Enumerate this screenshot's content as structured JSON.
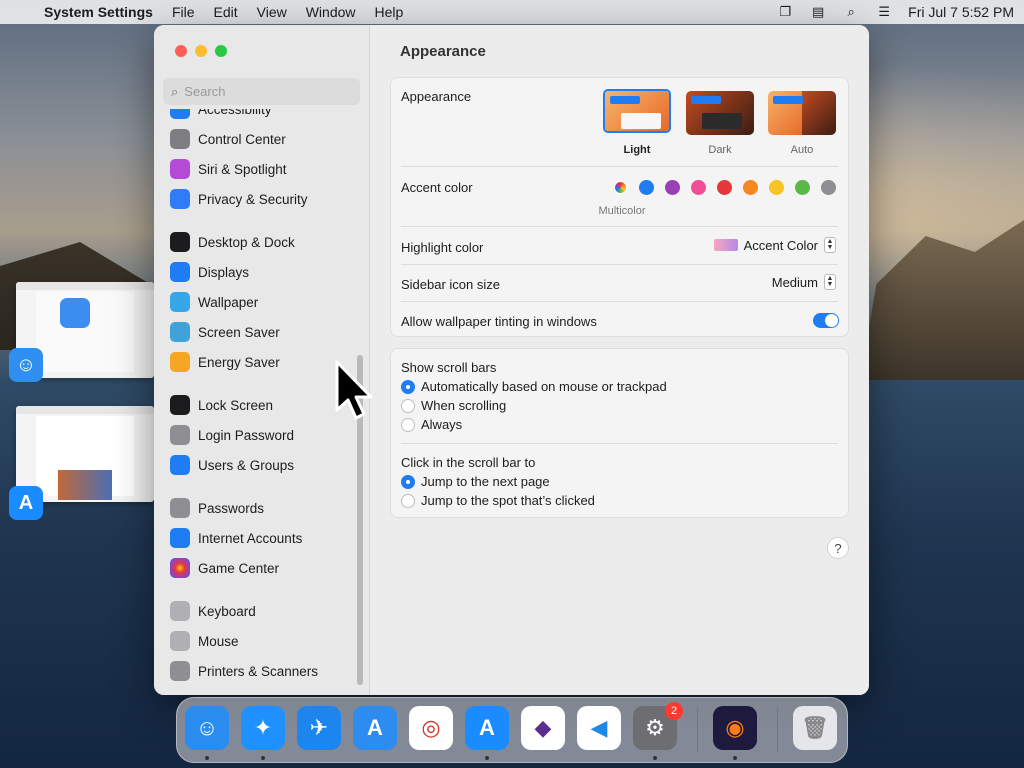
{
  "menubar": {
    "app_name": "System Settings",
    "menus": [
      "File",
      "Edit",
      "View",
      "Window",
      "Help"
    ],
    "clock": "Fri Jul 7  5:52 PM"
  },
  "sidebar": {
    "search_placeholder": "Search",
    "items": [
      {
        "label": "Accessibility",
        "icon": "accessibility-icon",
        "color": "#1f7cf2"
      },
      {
        "label": "Control Center",
        "icon": "control-center-icon",
        "color": "#7d7d82"
      },
      {
        "label": "Siri & Spotlight",
        "icon": "siri-icon",
        "color": "#b44bd6"
      },
      {
        "label": "Privacy & Security",
        "icon": "hand-icon",
        "color": "#2f7cf6"
      },
      {
        "label": "Desktop & Dock",
        "icon": "dock-icon",
        "color": "#1c1c1e"
      },
      {
        "label": "Displays",
        "icon": "sun-icon",
        "color": "#1f7cf2"
      },
      {
        "label": "Wallpaper",
        "icon": "flower-icon",
        "color": "#35a7e8"
      },
      {
        "label": "Screen Saver",
        "icon": "screen-saver-icon",
        "color": "#3fa2d8"
      },
      {
        "label": "Energy Saver",
        "icon": "bulb-icon",
        "color": "#f5a623"
      },
      {
        "label": "Lock Screen",
        "icon": "lock-icon",
        "color": "#1c1c1e"
      },
      {
        "label": "Login Password",
        "icon": "lock-gray-icon",
        "color": "#8e8e93"
      },
      {
        "label": "Users & Groups",
        "icon": "users-icon",
        "color": "#1f7cf2"
      },
      {
        "label": "Passwords",
        "icon": "key-icon",
        "color": "#8e8e93"
      },
      {
        "label": "Internet Accounts",
        "icon": "at-icon",
        "color": "#1f7cf2"
      },
      {
        "label": "Game Center",
        "icon": "game-center-icon",
        "color": "#ffffff"
      },
      {
        "label": "Keyboard",
        "icon": "keyboard-icon",
        "color": "#b0b0b4"
      },
      {
        "label": "Mouse",
        "icon": "mouse-icon",
        "color": "#b0b0b4"
      },
      {
        "label": "Printers & Scanners",
        "icon": "printer-icon",
        "color": "#8e8e93"
      }
    ]
  },
  "content": {
    "title": "Appearance",
    "appearance": {
      "label": "Appearance",
      "options": [
        {
          "label": "Light",
          "selected": true
        },
        {
          "label": "Dark",
          "selected": false
        },
        {
          "label": "Auto",
          "selected": false
        }
      ]
    },
    "accent": {
      "label": "Accent color",
      "caption": "Multicolor",
      "colors": [
        "multicolor",
        "#1f7cf2",
        "#9b3fb5",
        "#f24e98",
        "#e5383b",
        "#f5871f",
        "#f7c325",
        "#58b947",
        "#8e8e93"
      ]
    },
    "highlight": {
      "label": "Highlight color",
      "value": "Accent Color"
    },
    "sidebar_icon_size": {
      "label": "Sidebar icon size",
      "value": "Medium"
    },
    "wallpaper_tinting": {
      "label": "Allow wallpaper tinting in windows",
      "on": true
    },
    "scroll_bars": {
      "label": "Show scroll bars",
      "options": [
        "Automatically based on mouse or trackpad",
        "When scrolling",
        "Always"
      ],
      "selected": 0
    },
    "click_scroll": {
      "label": "Click in the scroll bar to",
      "options": [
        "Jump to the next page",
        "Jump to the spot that’s clicked"
      ],
      "selected": 0
    },
    "help_label": "?"
  },
  "dock": {
    "apps": [
      {
        "name": "finder-icon",
        "glyph": "☺",
        "color": "#2b8cf0",
        "running": true
      },
      {
        "name": "safari-icon",
        "glyph": "✦",
        "color": "#1e90ff",
        "running": true
      },
      {
        "name": "testflight-icon",
        "glyph": "✈",
        "color": "#1c86ee",
        "running": false
      },
      {
        "name": "xcode-appstore-icon",
        "glyph": "A",
        "color": "#2d8cf0",
        "running": false
      },
      {
        "name": "chrome-icon",
        "glyph": "◎",
        "color": "#ffffff",
        "running": false
      },
      {
        "name": "app-store-icon",
        "glyph": "A",
        "color": "#1b8cff",
        "running": true
      },
      {
        "name": "visual-studio-icon",
        "glyph": "◆",
        "color": "#ffffff",
        "running": false
      },
      {
        "name": "vscode-icon",
        "glyph": "◀",
        "color": "#ffffff",
        "running": false
      },
      {
        "name": "system-settings-icon",
        "glyph": "⚙",
        "color": "#6d6d72",
        "running": true,
        "badge": "2"
      },
      {
        "name": "firefox-icon",
        "glyph": "◉",
        "color": "#1e1a3e",
        "running": true
      },
      {
        "name": "trash-icon",
        "glyph": "🗑",
        "color": "#e6e6ea",
        "running": false
      }
    ]
  }
}
